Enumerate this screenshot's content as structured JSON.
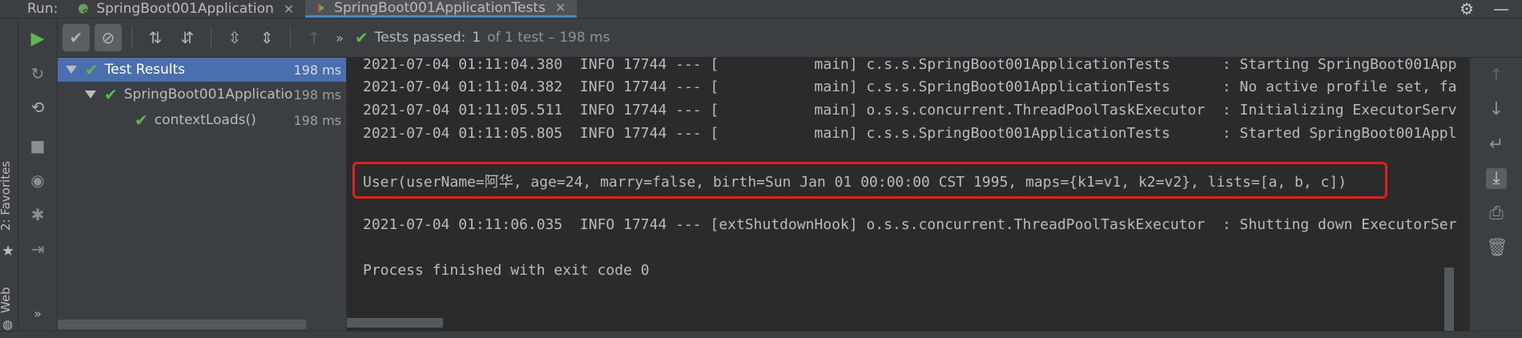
{
  "run_label": "Run:",
  "tabs": [
    {
      "label": "SpringBoot001Application"
    },
    {
      "label": "SpringBoot001ApplicationTests"
    }
  ],
  "left_strip": {
    "favorites": "2: Favorites",
    "web": "Web"
  },
  "toolbar": {
    "status_main": "Tests passed:",
    "status_count": "1",
    "status_rest": "of 1 test – 198 ms"
  },
  "tree": [
    {
      "label": "Test Results",
      "duration": "198 ms"
    },
    {
      "label": "SpringBoot001Applicatio",
      "duration": "198 ms"
    },
    {
      "label": "contextLoads()",
      "duration": "198 ms"
    }
  ],
  "console": {
    "lines": [
      "2021-07-04 01:11:04.380  INFO 17744 --- [           main] c.s.s.SpringBoot001ApplicationTests      : Starting SpringBoot001App",
      "2021-07-04 01:11:04.382  INFO 17744 --- [           main] c.s.s.SpringBoot001ApplicationTests      : No active profile set, fa",
      "2021-07-04 01:11:05.511  INFO 17744 --- [           main] o.s.s.concurrent.ThreadPoolTaskExecutor  : Initializing ExecutorServ",
      "2021-07-04 01:11:05.805  INFO 17744 --- [           main] c.s.s.SpringBoot001ApplicationTests      : Started SpringBoot001Appl",
      "User(userName=阿华, age=24, marry=false, birth=Sun Jan 01 00:00:00 CST 1995, maps={k1=v1, k2=v2}, lists=[a, b, c])",
      "2021-07-04 01:11:06.035  INFO 17744 --- [extShutdownHook] o.s.s.concurrent.ThreadPoolTaskExecutor  : Shutting down ExecutorSer",
      "Process finished with exit code 0"
    ]
  },
  "colors": {
    "pass": "#5fb84a",
    "highlight": "#e0201f",
    "selection": "#4b6eaf"
  }
}
